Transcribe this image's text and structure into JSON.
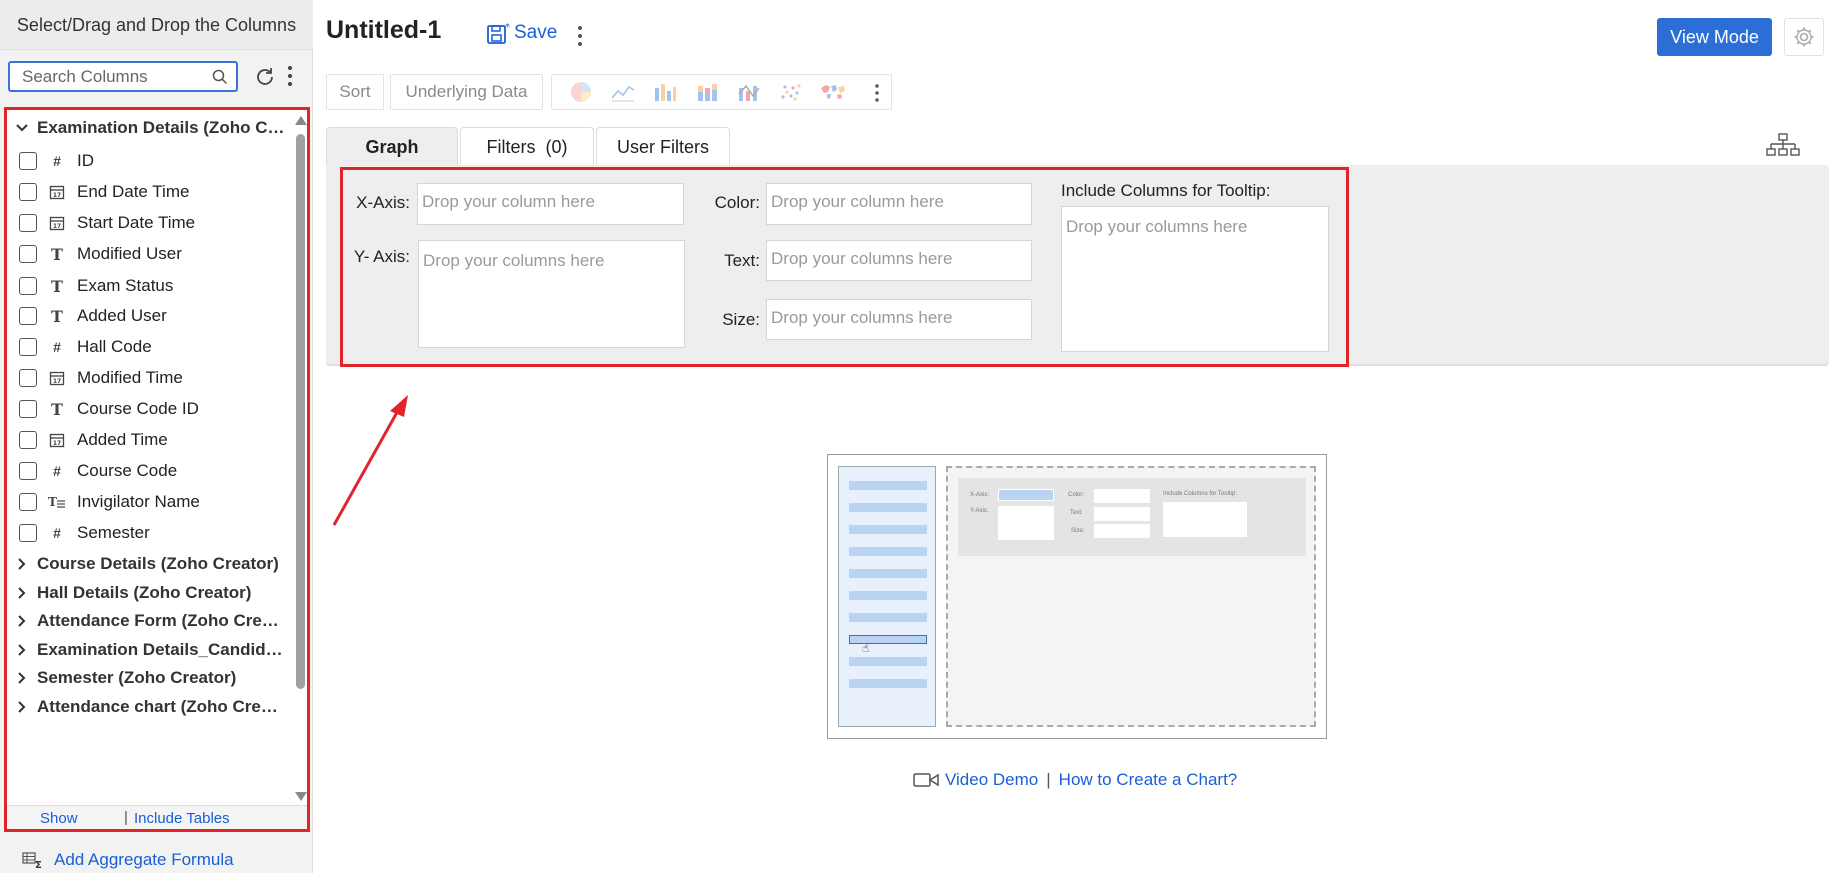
{
  "sidebar": {
    "title": "Select/Drag and Drop the Columns",
    "search_placeholder": "Search Columns",
    "tables": [
      {
        "label": "Examination Details (Zoho Cr...",
        "expanded": true,
        "columns": [
          {
            "label": "ID",
            "type": "number"
          },
          {
            "label": "End Date Time",
            "type": "date"
          },
          {
            "label": "Start Date Time",
            "type": "date"
          },
          {
            "label": "Modified User",
            "type": "text"
          },
          {
            "label": "Exam Status",
            "type": "text"
          },
          {
            "label": "Added User",
            "type": "text"
          },
          {
            "label": "Hall Code",
            "type": "number"
          },
          {
            "label": "Modified Time",
            "type": "date"
          },
          {
            "label": "Course Code ID",
            "type": "text"
          },
          {
            "label": "Added Time",
            "type": "date"
          },
          {
            "label": "Course Code",
            "type": "number"
          },
          {
            "label": "Invigilator Name",
            "type": "multiline-text"
          },
          {
            "label": "Semester",
            "type": "number"
          }
        ]
      },
      {
        "label": "Course Details (Zoho Creator)",
        "expanded": false
      },
      {
        "label": "Hall Details (Zoho Creator)",
        "expanded": false
      },
      {
        "label": "Attendance Form (Zoho Creat...",
        "expanded": false
      },
      {
        "label": "Examination Details_Candidat...",
        "expanded": false
      },
      {
        "label": "Semester (Zoho Creator)",
        "expanded": false
      },
      {
        "label": "Attendance chart (Zoho Creat...",
        "expanded": false
      }
    ],
    "footer": {
      "show": "Show",
      "separator": "|",
      "include_tables": "Include Tables"
    },
    "add_aggregate": "Add Aggregate Formula"
  },
  "header": {
    "title": "Untitled-1",
    "save_label": "Save",
    "view_mode_label": "View Mode"
  },
  "toolbar": {
    "sort": "Sort",
    "underlying_data": "Underlying Data",
    "chart_icons": [
      "pie-chart-icon",
      "line-chart-icon",
      "bar-chart-icon",
      "stacked-bar-icon",
      "combo-chart-icon",
      "scatter-chart-icon",
      "map-chart-icon"
    ]
  },
  "tabs": [
    {
      "label": "Graph",
      "active": true
    },
    {
      "label": "Filters  (0)",
      "active": false
    },
    {
      "label": "User Filters",
      "active": false
    }
  ],
  "shelf": {
    "x_axis_label": "X-Axis:",
    "x_axis_placeholder": "Drop your column here",
    "y_axis_label": "Y- Axis:",
    "y_axis_placeholder": "Drop your columns here",
    "color_label": "Color:",
    "color_placeholder": "Drop your column here",
    "text_label": "Text:",
    "text_placeholder": "Drop your columns here",
    "size_label": "Size:",
    "size_placeholder": "Drop your columns here",
    "tooltip_label": "Include Columns for Tooltip:",
    "tooltip_placeholder": "Drop your columns here"
  },
  "illustration": {
    "x_axis": "X-Axis:",
    "y_axis": "Y-Axis:",
    "color": "Color:",
    "text": "Text:",
    "size": "Size:",
    "tooltip": "Include Columns for Tooltip:"
  },
  "help": {
    "video_demo": "Video Demo",
    "separator": "|",
    "how_to": "How to Create a Chart?"
  },
  "colors": {
    "accent": "#2b6fd6",
    "link": "#1a5fd6",
    "highlight": "#e0242a"
  }
}
